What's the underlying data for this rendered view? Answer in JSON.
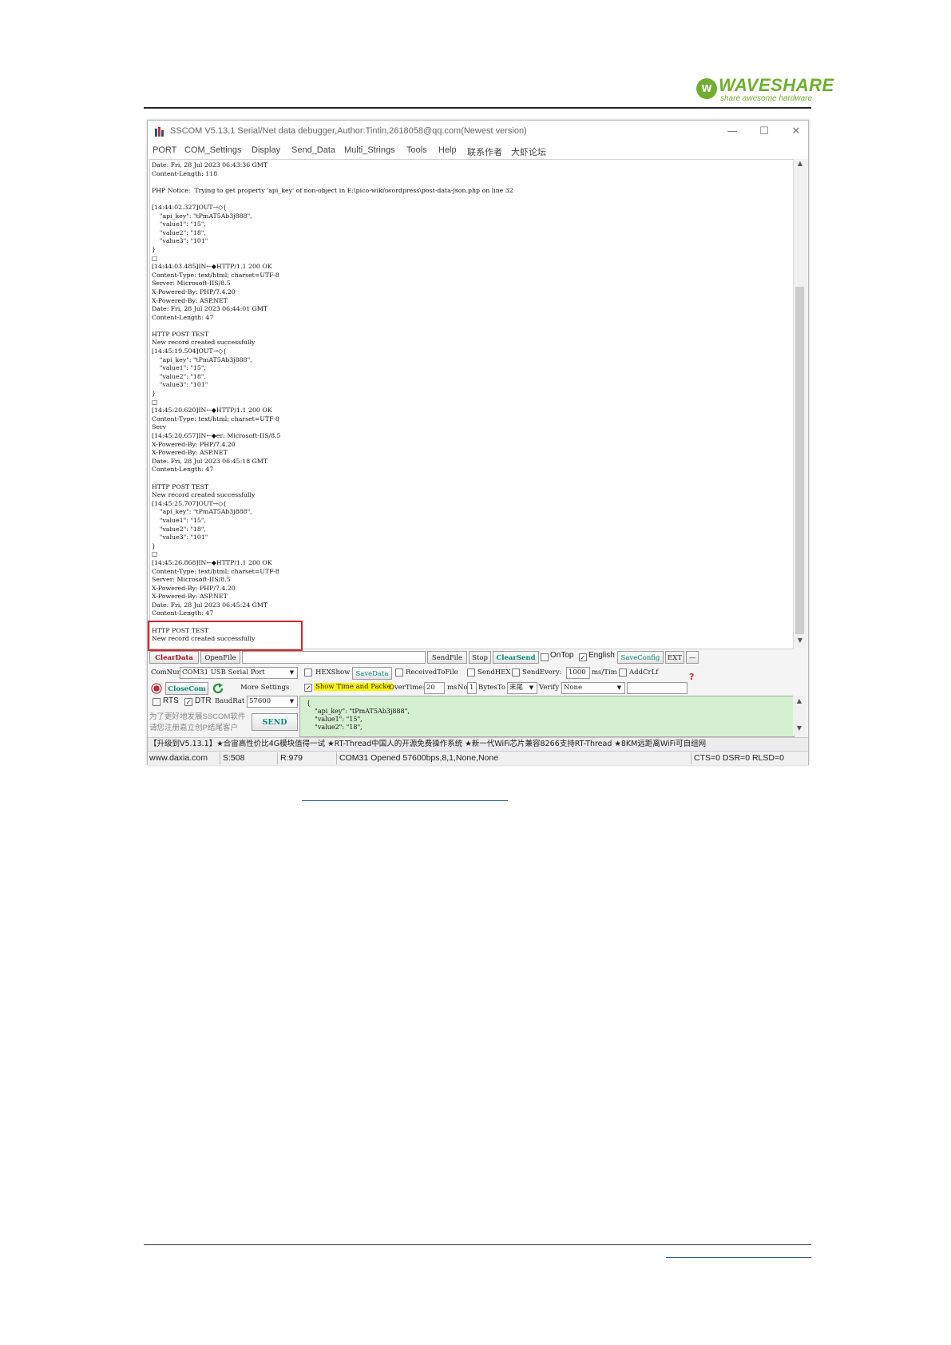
{
  "header": {
    "logo_brand": "WAVESHARE",
    "logo_tagline": "share awesome hardware"
  },
  "window": {
    "title": "SSCOM V5.13.1 Serial/Net data debugger,Author:Tintin,2618058@qq.com(Newest version)",
    "minimize": "—",
    "maximize": "☐",
    "close": "✕"
  },
  "menu": [
    "PORT",
    "COM_Settings",
    "Display",
    "Send_Data",
    "Multi_Strings",
    "Tools",
    "Help",
    "联系作者",
    "大虾论坛"
  ],
  "receive_lines": [
    "Date: Fri, 28 Jul 2023 06:43:36 GMT",
    "Content-Length: 118",
    "",
    "PHP Notice:  Trying to get property 'api_key' of non-object in E:\\pico-wiki\\wordpress\\post-data-json.php on line 32",
    "",
    "[14:44:02.327]OUT→◇{",
    "    \"api_key\": \"tPmAT5Ab3j888\",",
    "    \"value1\": \"15\",",
    "    \"value2\": \"18\",",
    "    \"value3\": \"101\"",
    "}",
    "□",
    "[14:44:03.485]IN←◆HTTP/1.1 200 OK",
    "Content-Type: text/html; charset=UTF-8",
    "Server: Microsoft-IIS/8.5",
    "X-Powered-By: PHP/7.4.20",
    "X-Powered-By: ASP.NET",
    "Date: Fri, 28 Jul 2023 06:44:01 GMT",
    "Content-Length: 47",
    "",
    "HTTP POST TEST",
    "New record created successfully",
    "[14:45:19.504]OUT→◇{",
    "    \"api_key\": \"tPmAT5Ab3j888\",",
    "    \"value1\": \"15\",",
    "    \"value2\": \"18\",",
    "    \"value3\": \"101\"",
    "}",
    "□",
    "[14:45:20.620]IN←◆HTTP/1.1 200 OK",
    "Content-Type: text/html; charset=UTF-8",
    "Serv",
    "[14:45:20.657]IN←◆er: Microsoft-IIS/8.5",
    "X-Powered-By: PHP/7.4.20",
    "X-Powered-By: ASP.NET",
    "Date: Fri, 28 Jul 2023 06:45:18 GMT",
    "Content-Length: 47",
    "",
    "HTTP POST TEST",
    "New record created successfully",
    "[14:45:25.707]OUT→◇{",
    "    \"api_key\": \"tPmAT5Ab3j888\",",
    "    \"value1\": \"15\",",
    "    \"value2\": \"18\",",
    "    \"value3\": \"101\"",
    "}",
    "□",
    "[14:45:26.868]IN←◆HTTP/1.1 200 OK",
    "Content-Type: text/html; charset=UTF-8",
    "Server: Microsoft-IIS/8.5",
    "X-Powered-By: PHP/7.4.20",
    "X-Powered-By: ASP.NET",
    "Date: Fri, 28 Jul 2023 06:45:24 GMT",
    "Content-Length: 47",
    "",
    "HTTP POST TEST",
    "New record created successfully"
  ],
  "toolbar": {
    "clear_data": "ClearData",
    "open_file": "OpenFile",
    "file_path": "",
    "send_file": "SendFile",
    "stop": "Stop",
    "clear_send": "ClearSend",
    "on_top": "OnTop",
    "english": "English",
    "save_config": "SaveConfig",
    "ext": "EXT",
    "collapse": "—"
  },
  "port": {
    "com_num_label": "ComNum",
    "com_num_value": "COM31 USB Serial Port",
    "close_com": "CloseCom",
    "more_settings": "More Settings",
    "rts": "RTS",
    "dtr": "DTR",
    "baud_label": "BaudRat",
    "baud_value": "57600",
    "promo1": "为了更好地发展SSCOM软件",
    "promo2": "请您注册嘉立创P结尾客户"
  },
  "options": {
    "hex_show": "HEXShow",
    "save_data": "SaveData",
    "receive_to_file": "ReceivedToFile",
    "send_hex": "SendHEX",
    "send_every": "SendEvery:",
    "send_every_value": "1000",
    "ms_tim": "ms/Tim",
    "add_crlf": "AddCrLf",
    "show_time": "Show Time and Packe",
    "overtime": "OverTime:",
    "overtime_value": "20",
    "ms": "ms",
    "no": "No",
    "no_value": "1",
    "bytes_to": "BytesTo",
    "bytes_to_value": "末尾",
    "verify": "Verify",
    "verify_value": "None",
    "help_mark": "?"
  },
  "send": {
    "send_button": "SEND",
    "lines": [
      "{",
      "    \"api_key\": \"tPmAT5Ab3j888\",",
      "    \"value1\": \"15\",",
      "    \"value2\": \"18\","
    ]
  },
  "ad_text": "【升级到V5.13.1】★合宙高性价比4G模块值得一试 ★RT-Thread中国人的开源免费操作系统 ★新一代WiFi芯片兼容8266支持RT-Thread ★8KM远距离WiFi可自组网",
  "status": {
    "site": "www.daxia.com",
    "sent": "S:508",
    "received": "R:979",
    "port_state": "COM31 Opened  57600bps,8,1,None,None",
    "lines": "CTS=0 DSR=0 RLSD=0"
  }
}
